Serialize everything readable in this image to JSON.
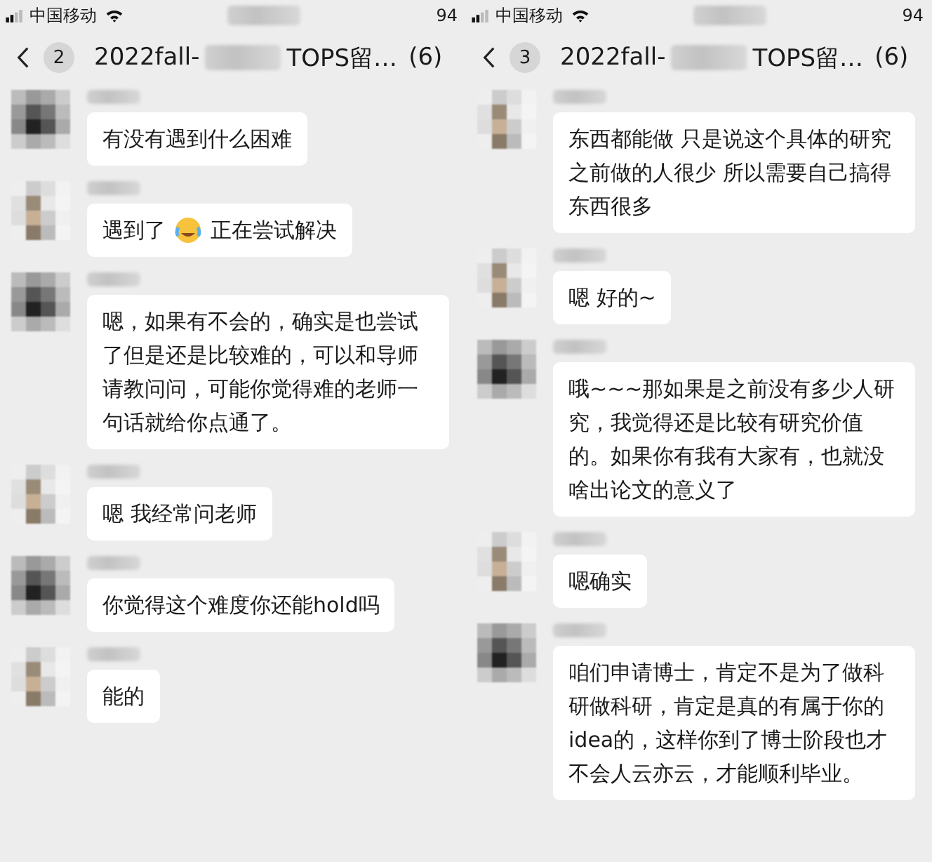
{
  "panels": [
    {
      "status": {
        "carrier": "中国移动",
        "battery": "94"
      },
      "header": {
        "unread": "2",
        "title_start": "2022fall-",
        "title_end": "TOPS留…",
        "count": "(6)"
      },
      "messages": [
        {
          "kind": "dark",
          "parts": [
            {
              "kind": "text",
              "text": "有没有遇到什么困难"
            }
          ]
        },
        {
          "kind": "light",
          "parts": [
            {
              "kind": "text",
              "text": "遇到了"
            },
            {
              "kind": "emoji"
            },
            {
              "kind": "text",
              "text": "正在尝试解决"
            }
          ]
        },
        {
          "kind": "dark",
          "parts": [
            {
              "kind": "text",
              "text": "嗯，如果有不会的，确实是也尝试了但是还是比较难的，可以和导师请教问问，可能你觉得难的老师一句话就给你点通了。"
            }
          ]
        },
        {
          "kind": "light",
          "parts": [
            {
              "kind": "text",
              "text": "嗯 我经常问老师"
            }
          ]
        },
        {
          "kind": "dark",
          "parts": [
            {
              "kind": "text",
              "text": "你觉得这个难度你还能hold吗"
            }
          ]
        },
        {
          "kind": "light",
          "parts": [
            {
              "kind": "text",
              "text": "能的"
            }
          ]
        }
      ]
    },
    {
      "status": {
        "carrier": "中国移动",
        "battery": "94"
      },
      "header": {
        "unread": "3",
        "title_start": "2022fall-",
        "title_end": "TOPS留…",
        "count": "(6)"
      },
      "messages": [
        {
          "kind": "light",
          "parts": [
            {
              "kind": "text",
              "text": "东西都能做 只是说这个具体的研究之前做的人很少 所以需要自己搞得东西很多"
            }
          ]
        },
        {
          "kind": "light",
          "parts": [
            {
              "kind": "text",
              "text": "嗯 好的~"
            }
          ]
        },
        {
          "kind": "dark",
          "parts": [
            {
              "kind": "text",
              "text": "哦~~~那如果是之前没有多少人研究，我觉得还是比较有研究价值的。如果你有我有大家有，也就没啥出论文的意义了"
            }
          ]
        },
        {
          "kind": "light",
          "parts": [
            {
              "kind": "text",
              "text": "嗯确实"
            }
          ]
        },
        {
          "kind": "dark",
          "parts": [
            {
              "kind": "text",
              "text": "咱们申请博士，肯定不是为了做科研做科研，肯定是真的有属于你的idea的，这样你到了博士阶段也才不会人云亦云，才能顺利毕业。"
            }
          ]
        }
      ]
    }
  ]
}
